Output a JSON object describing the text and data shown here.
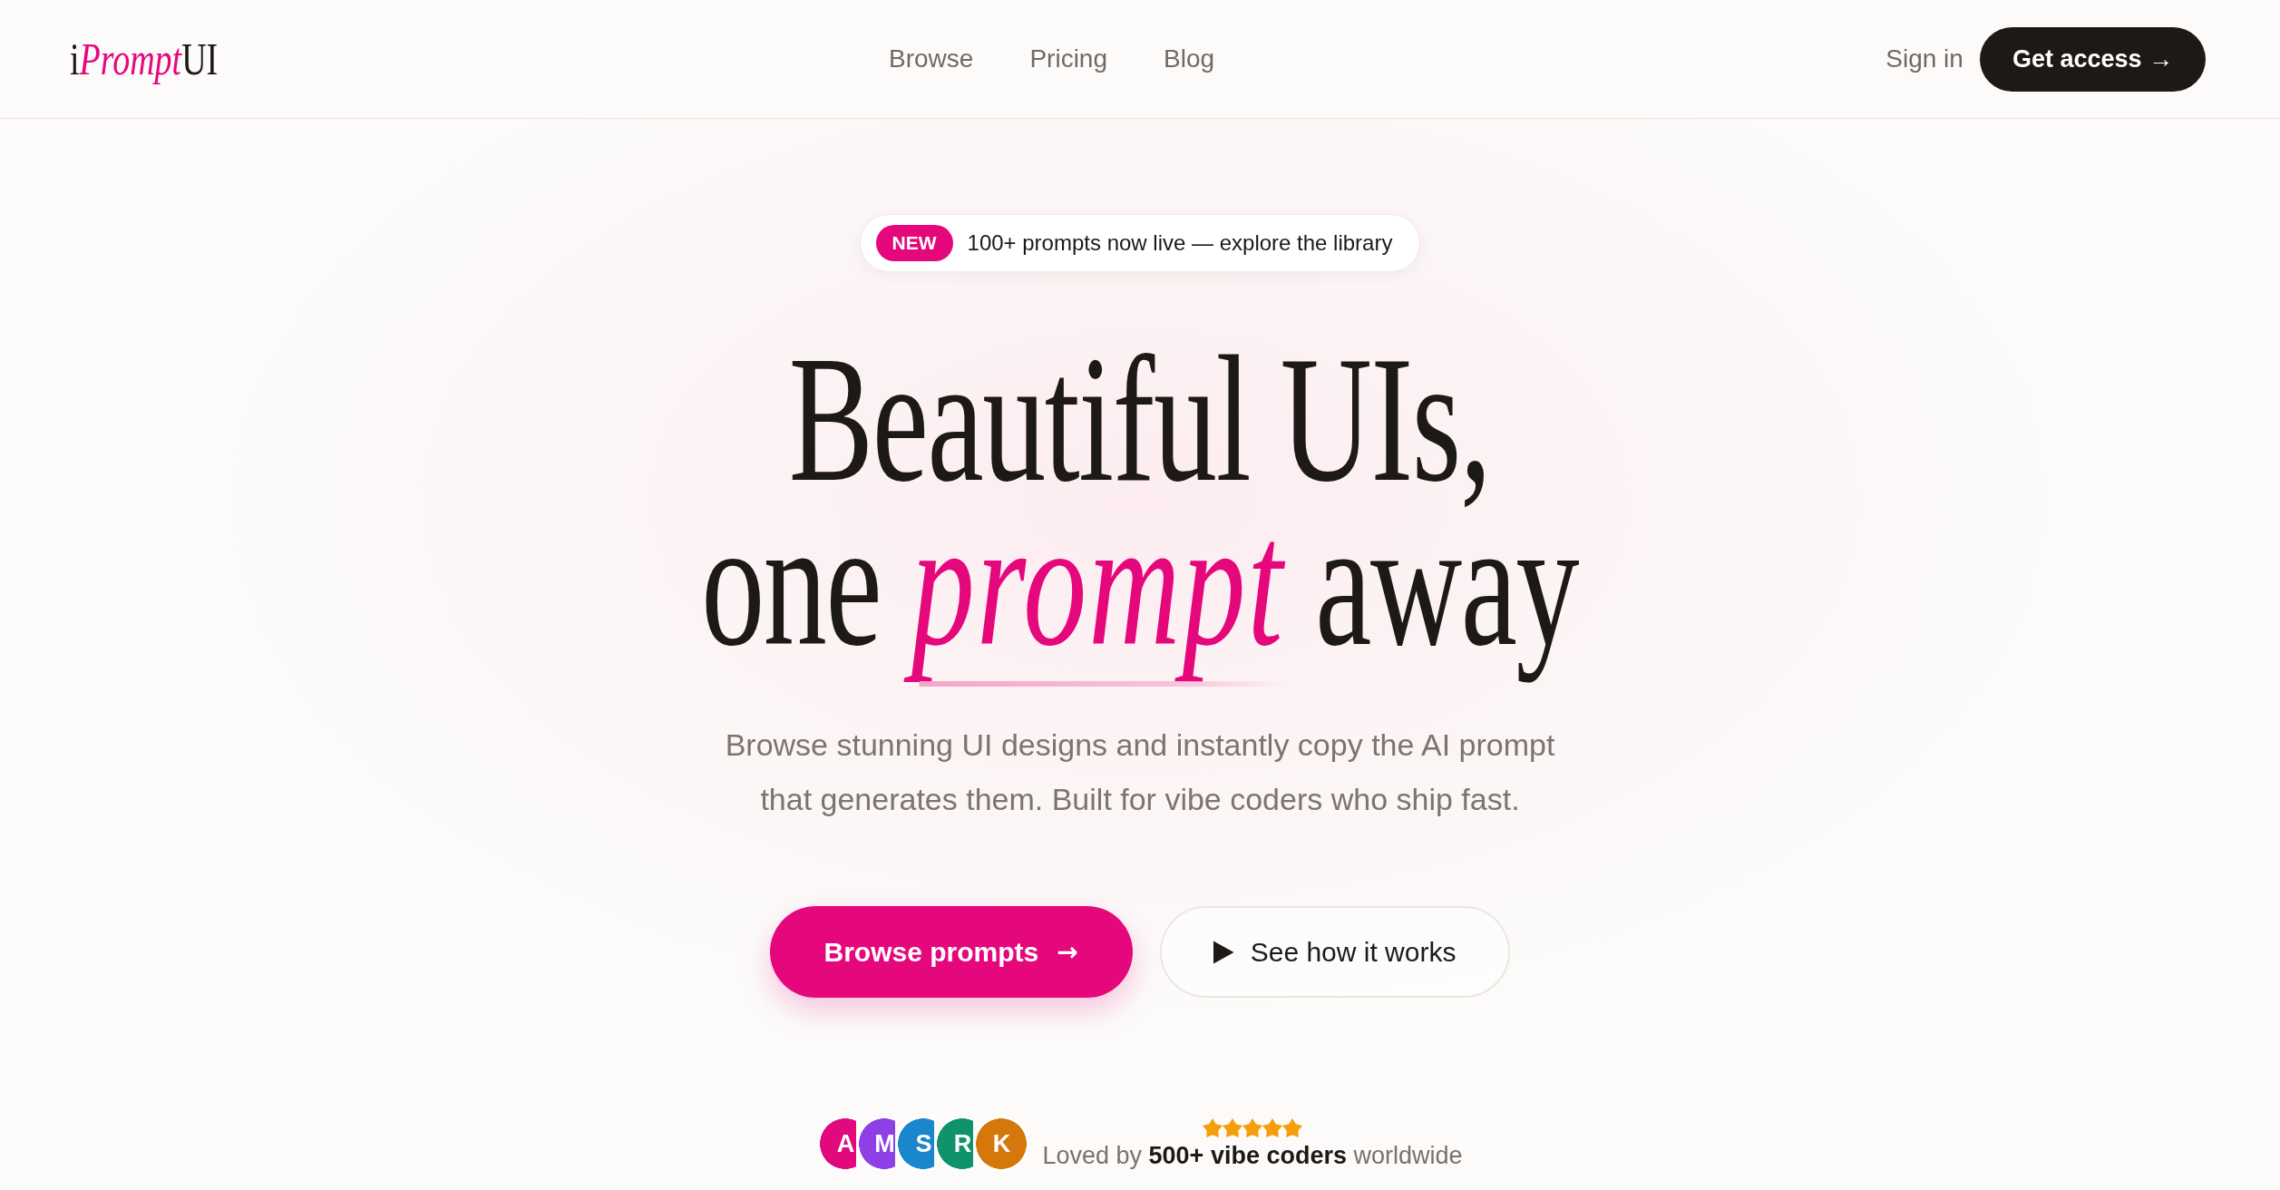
{
  "header": {
    "logo": {
      "prefix": "i",
      "accent": "Prompt",
      "suffix": "UI"
    },
    "nav": [
      {
        "label": "Browse"
      },
      {
        "label": "Pricing"
      },
      {
        "label": "Blog"
      }
    ],
    "sign_in": "Sign in",
    "cta": "Get access →"
  },
  "hero": {
    "badge": {
      "tag": "NEW",
      "text": "100+ prompts now live — explore the library"
    },
    "headline": [
      "Beautiful UIs,",
      "one *prompt* away"
    ],
    "subtitle": "Browse stunning UI designs and instantly copy the AI prompt\nthat generates them. Built for vibe coders who ship fast.",
    "buttons": [
      {
        "kind": "primary",
        "label": "Browse prompts",
        "trailing_symbol": "→"
      },
      {
        "kind": "secondary",
        "label": "See how it works"
      }
    ],
    "social_proof": {
      "avatars": [
        {
          "initial": "A",
          "color": "#e0097d"
        },
        {
          "initial": "M",
          "color": "#8e3fe6"
        },
        {
          "initial": "S",
          "color": "#1a86cc"
        },
        {
          "initial": "R",
          "color": "#10936a"
        },
        {
          "initial": "K",
          "color": "#d5770a"
        }
      ],
      "stars": 5,
      "text": "Loved by **500+ vibe coders** worldwide"
    }
  }
}
